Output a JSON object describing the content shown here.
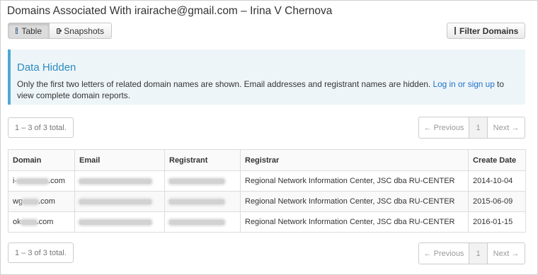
{
  "header": {
    "title": "Domains Associated With irairache@gmail.com – Irina V Chernova"
  },
  "toolbar": {
    "table_label": "Table",
    "snapshots_label": "Snapshots",
    "filter_label": "Filter Domains",
    "icons": {
      "table": "table-icon",
      "snapshots": "camera-icon",
      "filter": "filter-icon"
    }
  },
  "alert": {
    "title": "Data Hidden",
    "body_before": "Only the first two letters of related domain names are shown. Email addresses and registrant names are hidden. ",
    "link": "Log in or sign up",
    "body_after": " to view complete domain reports."
  },
  "pagination": {
    "total_text": "1 – 3 of 3 total.",
    "previous": "← Previous",
    "page": "1",
    "next": "Next →"
  },
  "table": {
    "columns": [
      "Domain",
      "Email",
      "Registrant",
      "Registrar",
      "Create Date"
    ],
    "rows": [
      {
        "domain_prefix": "i-",
        "domain_suffix": ".com",
        "registrar": "Regional Network Information Center, JSC dba RU-CENTER",
        "create_date": "2014-10-04"
      },
      {
        "domain_prefix": "wg",
        "domain_suffix": ".com",
        "registrar": "Regional Network Information Center, JSC dba RU-CENTER",
        "create_date": "2015-06-09"
      },
      {
        "domain_prefix": "ok",
        "domain_suffix": ".com",
        "registrar": "Regional Network Information Center, JSC dba RU-CENTER",
        "create_date": "2016-01-15"
      }
    ]
  },
  "colors": {
    "alert_accent": "#4fa9d4",
    "alert_title": "#2c8bbf",
    "link": "#1e73c8"
  }
}
